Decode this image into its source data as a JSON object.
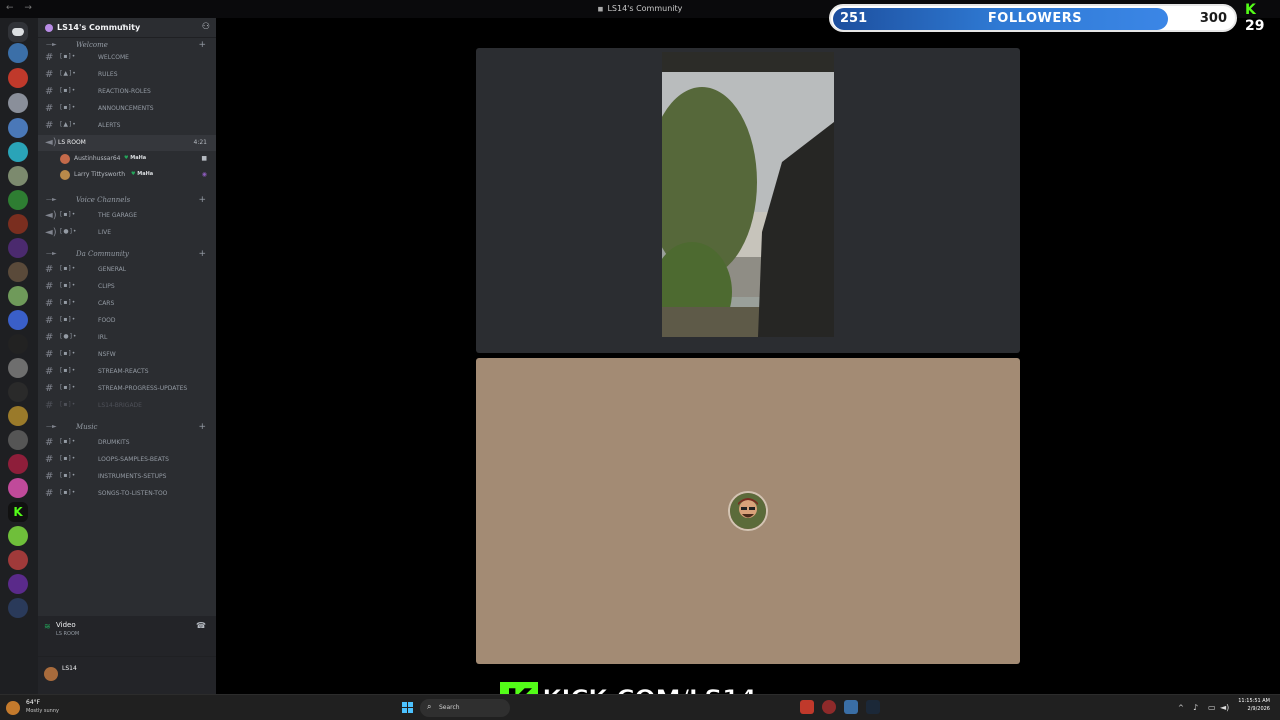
{
  "window": {
    "nav": "← →",
    "title": "LS14's Community"
  },
  "sidebar": {
    "server_name": "LS14's Community",
    "categories": {
      "welcome": "Welcome",
      "voice": "Voice Channels",
      "community": "Da Community",
      "music": "Music"
    },
    "welcome_channels": [
      "WELCOME",
      "RULES",
      "REACTION-ROLES",
      "ANNOUNCEMENTS",
      "ALERTS"
    ],
    "voice_room": {
      "name": "LS ROOM",
      "time": "4:21",
      "members": [
        {
          "name": "Austinhussar64",
          "tag": "MaHa"
        },
        {
          "name": "Larry Tittysworth",
          "tag": "MaHa"
        }
      ]
    },
    "voice_channels": [
      "THE GARAGE",
      "LIVE"
    ],
    "community_channels": [
      "GENERAL",
      "CLIPS",
      "CARS",
      "FOOD",
      "IRL",
      "NSFW",
      "STREAM-REACTS",
      "STREAM-PROGRESS-UPDATES",
      "LS14-BRIGADE"
    ],
    "music_channels": [
      "DRUMKITS",
      "LOOPS-SAMPLES-BEATS",
      "INSTRUMENTS-SETUPS",
      "SONGS-TO-LISTEN-TOO"
    ],
    "voice_status": {
      "label": "Video",
      "sub": "LS ROOM"
    },
    "user": {
      "name": "LS14"
    }
  },
  "overlay": {
    "followers_current": "251",
    "followers_label": "FOLLOWERS",
    "followers_goal": "300",
    "followers_progress": 0.837,
    "kick_viewers": "29",
    "kick_url": "KICK.COM/LS14",
    "kick_letter": "K"
  },
  "taskbar": {
    "weather_temp": "64°F",
    "weather_desc": "Mostly sunny",
    "search_placeholder": "Search",
    "time": "11:15:51 AM",
    "date": "2/9/2026"
  },
  "colors": {
    "kick_green": "#53fc18",
    "discord_bg": "#2b2d31",
    "avatar_tile": "#a38b74",
    "progress_blue": "#2f7ad4"
  }
}
